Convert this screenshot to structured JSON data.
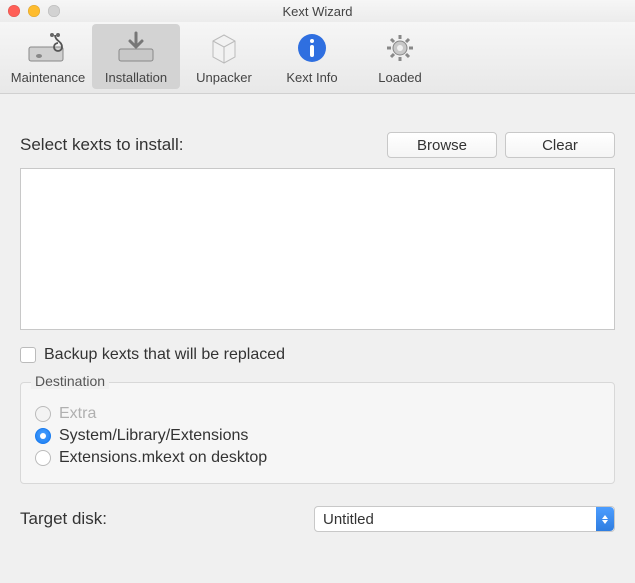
{
  "window": {
    "title": "Kext Wizard"
  },
  "toolbar": {
    "items": [
      {
        "label": "Maintenance"
      },
      {
        "label": "Installation"
      },
      {
        "label": "Unpacker"
      },
      {
        "label": "Kext Info"
      },
      {
        "label": "Loaded"
      }
    ],
    "active_index": 1
  },
  "main": {
    "select_label": "Select kexts to install:",
    "browse_label": "Browse",
    "clear_label": "Clear",
    "backup_checkbox": "Backup kexts that will be replaced",
    "backup_checked": false,
    "destination": {
      "legend": "Destination",
      "options": [
        {
          "label": "Extra"
        },
        {
          "label": "System/Library/Extensions"
        },
        {
          "label": "Extensions.mkext on desktop"
        }
      ],
      "selected_index": 1,
      "disabled_index": 0
    },
    "target": {
      "label": "Target disk:",
      "value": "Untitled"
    }
  }
}
